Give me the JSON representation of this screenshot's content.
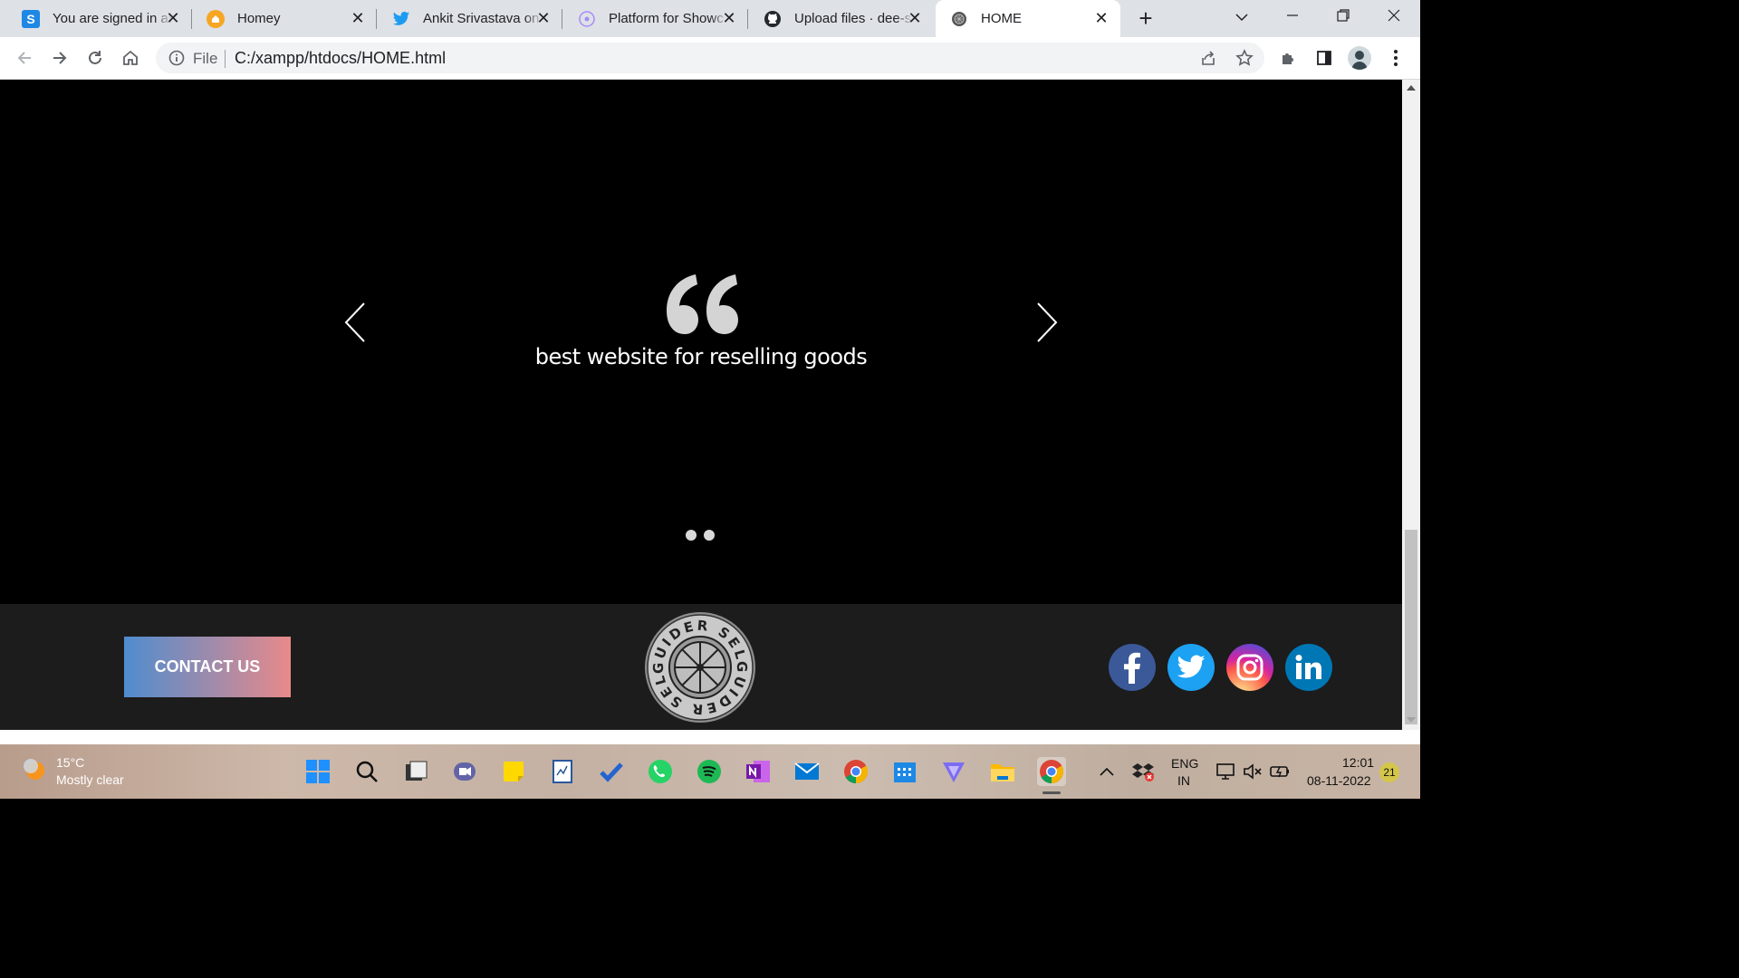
{
  "browser": {
    "tabs": [
      {
        "title": "You are signed in as",
        "icon": "s-icon",
        "color": "#1e88e5"
      },
      {
        "title": "Homey",
        "icon": "homey-icon",
        "color": "#f6a623"
      },
      {
        "title": "Ankit Srivastava on",
        "icon": "twitter-icon",
        "color": "#1d9bf0"
      },
      {
        "title": "Platform for Showc",
        "icon": "platform-icon",
        "color": "#a78bfa"
      },
      {
        "title": "Upload files · dee-s",
        "icon": "github-icon",
        "color": "#24292f"
      },
      {
        "title": "HOME",
        "icon": "page-icon",
        "color": "#555555"
      }
    ],
    "new_tab": "+",
    "omnibox": {
      "scheme_label": "File",
      "url": "C:/xampp/htdocs/HOME.html"
    }
  },
  "page": {
    "testimonial": {
      "text": "best website for reselling goods",
      "slide_count": 2,
      "active_slide": 1
    },
    "footer": {
      "contact_label": "CONTACT US",
      "logo_text": "GUIDER SELL",
      "social": [
        {
          "name": "facebook",
          "glyph": "f",
          "color": "#3b5998"
        },
        {
          "name": "twitter",
          "glyph": "t",
          "color": "#1da1f2"
        },
        {
          "name": "instagram",
          "glyph": "i",
          "color": "#c13584"
        },
        {
          "name": "linkedin",
          "glyph": "in",
          "color": "#0077b5"
        }
      ]
    }
  },
  "taskbar": {
    "weather": {
      "temp": "15°C",
      "desc": "Mostly clear"
    },
    "lang": {
      "line1": "ENG",
      "line2": "IN"
    },
    "clock": {
      "time": "12:01",
      "date": "08-11-2022"
    },
    "notifications": "21"
  }
}
